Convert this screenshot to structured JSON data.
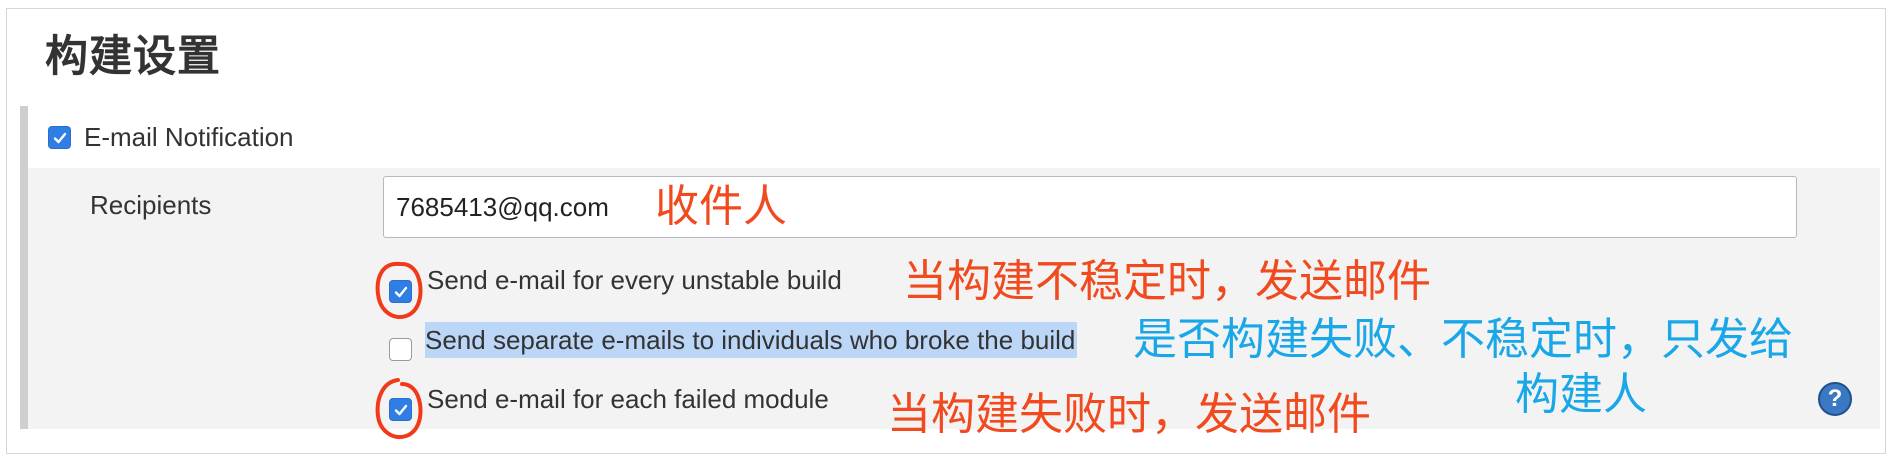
{
  "section": {
    "title": "构建设置"
  },
  "email_notification": {
    "label": "E-mail Notification",
    "checked": true,
    "recipients_label": "Recipients",
    "recipients_value": "7685413@qq.com",
    "options": [
      {
        "label": "Send e-mail for every unstable build",
        "checked": true
      },
      {
        "label": "Send separate e-mails to individuals who broke the build",
        "checked": false
      },
      {
        "label": "Send e-mail for each failed module",
        "checked": true
      }
    ],
    "help_icon": "help-icon"
  },
  "annotations": {
    "recipients": "收件人",
    "unstable": "当构建不稳定时，发送邮件",
    "individuals_line1": "是否构建失败、不稳定时，只发给",
    "individuals_line2": "构建人",
    "failed_module": "当构建失败时，发送邮件"
  },
  "colors": {
    "annotation_red": "#f04a1e",
    "annotation_blue": "#1aa7e8",
    "checkbox_blue": "#2f7ee6"
  }
}
